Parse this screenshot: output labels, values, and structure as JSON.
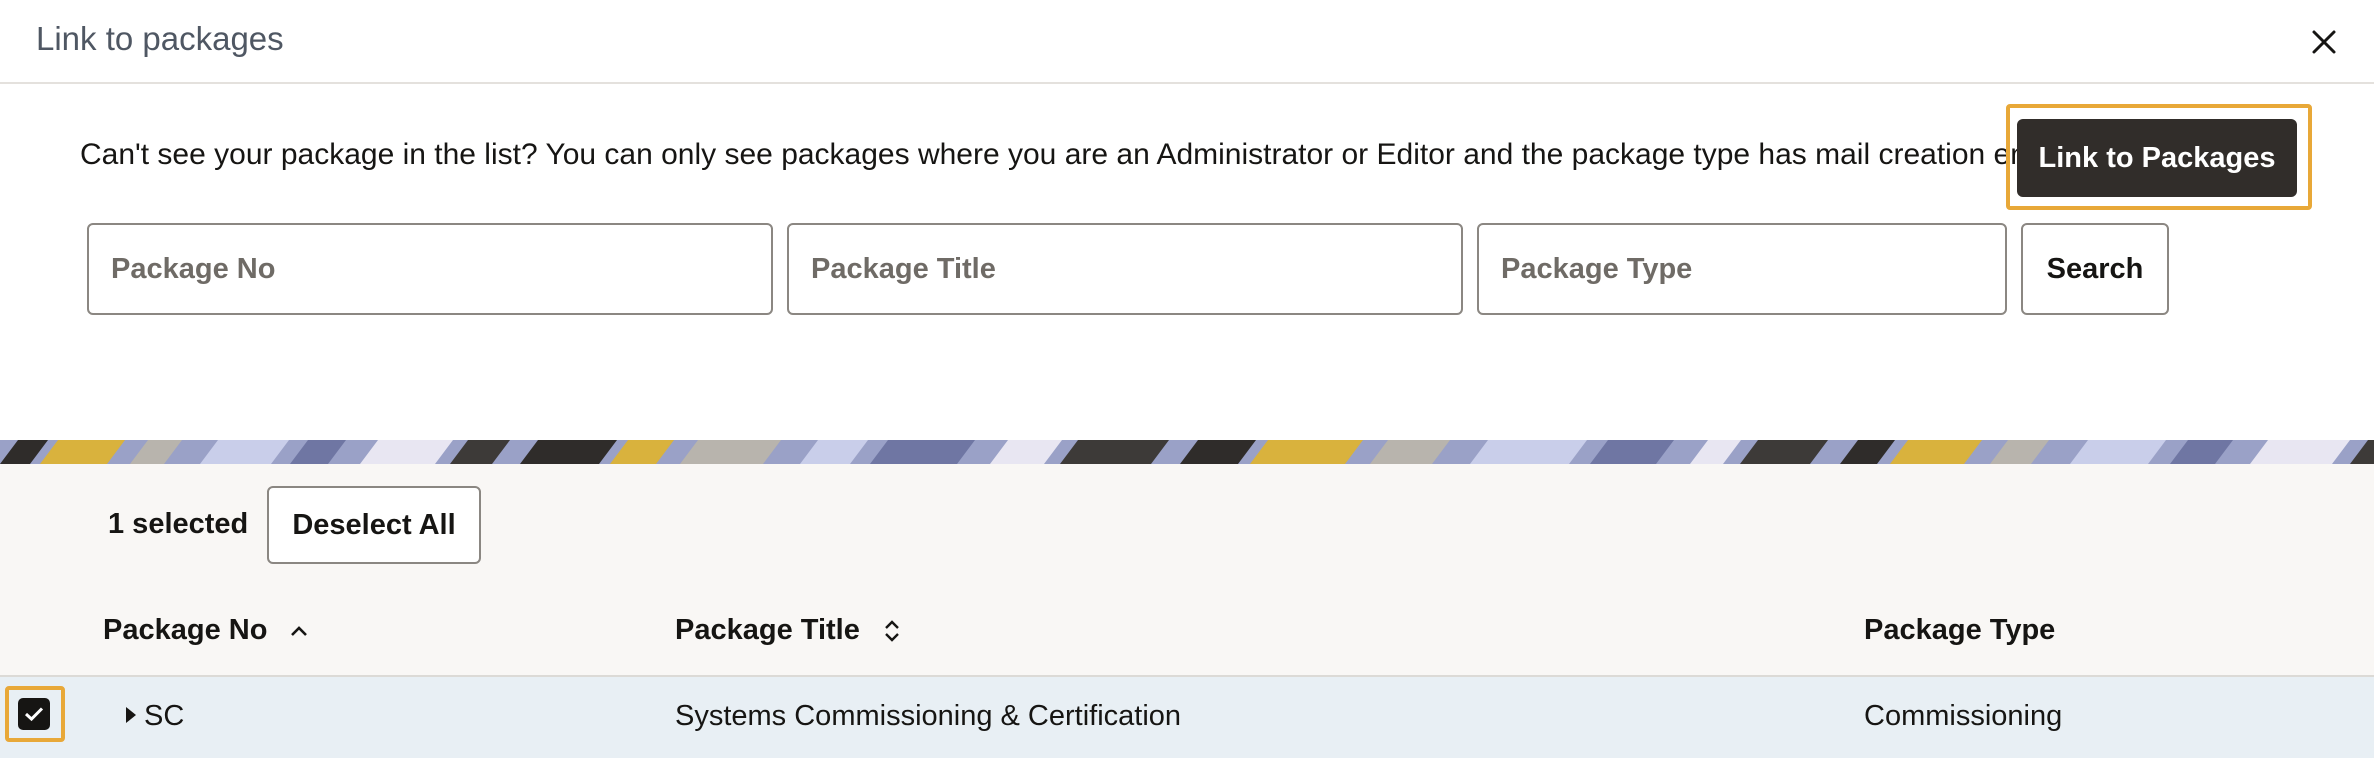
{
  "dialog": {
    "title": "Link to packages",
    "close_icon": "close-icon"
  },
  "info_text": "Can't see your package in the list? You can only see packages where you are an Administrator or Editor and the package type has mail creation enabled.",
  "primary_button": {
    "label": "Link to Packages"
  },
  "search": {
    "package_no_placeholder": "Package No",
    "package_title_placeholder": "Package Title",
    "package_type_placeholder": "Package Type",
    "button_label": "Search"
  },
  "selection": {
    "count_label": "1 selected",
    "deselect_label": "Deselect All"
  },
  "table": {
    "columns": [
      {
        "label": "Package No",
        "sort_icon": "sort-ascending-icon"
      },
      {
        "label": "Package Title",
        "sort_icon": "sort-unsorted-icon"
      },
      {
        "label": "Package Type"
      }
    ],
    "rows": [
      {
        "package_no": "SC",
        "package_title": "Systems Commissioning & Certification",
        "package_type": "Commissioning",
        "checked": true
      }
    ]
  },
  "colors": {
    "primary": "#312d2a",
    "focus_outline": "#e8a838",
    "row_highlight": "#e8eff4",
    "panel_background": "#f9f7f5"
  }
}
